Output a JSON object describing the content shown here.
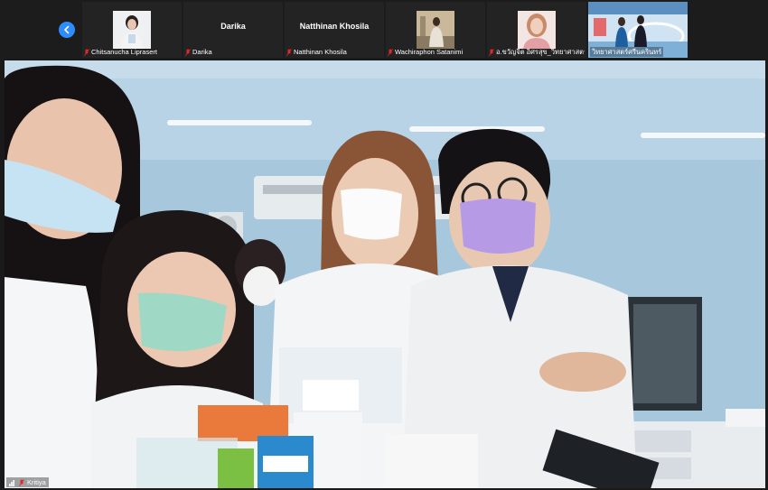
{
  "participants": [
    {
      "name": "Chitsanucha Liprasert",
      "muted": true,
      "has_video": true
    },
    {
      "name": "Darika",
      "muted": true,
      "has_video": false
    },
    {
      "name": "Natthinan Khosila",
      "muted": true,
      "has_video": false
    },
    {
      "name": "Wachiraphon Satanimi",
      "muted": true,
      "has_video": true
    },
    {
      "name": "อ.ขวัญจิต อิศรสุข_วิทยาศาสตร์ศึ...",
      "muted": true,
      "has_video": true
    },
    {
      "name": "วิทยาศาสตร์ศรีนครินทร์",
      "muted": false,
      "has_video": true
    }
  ],
  "main_speaker": {
    "name": "Kritiya",
    "muted": true
  },
  "colors": {
    "accent": "#2d8cff",
    "muted_icon": "#e02828",
    "bar_bg": "#1c1c1c"
  },
  "icons": {
    "prev_page": "chevron-left-icon",
    "muted": "mic-off-icon",
    "signal": "signal-bars-icon"
  }
}
